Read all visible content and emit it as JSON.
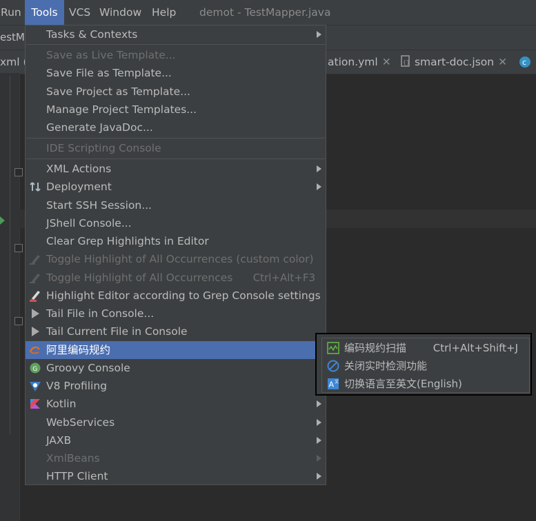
{
  "menubar": {
    "run": "Run",
    "tools": "Tools",
    "vcs": "VCS",
    "window": "Window",
    "help": "Help",
    "window_title": "demot - TestMapper.java"
  },
  "navbar": {
    "crumb": "estMa"
  },
  "tabs": [
    {
      "label": "xml (c"
    },
    {
      "label": "ation.yml"
    },
    {
      "label": "smart-doc.json"
    }
  ],
  "tools_menu": {
    "items": [
      {
        "label": "Tasks & Contexts",
        "submenu": true
      },
      {
        "label": "Save as Live Template...",
        "disabled": true
      },
      {
        "label": "Save File as Template..."
      },
      {
        "label": "Save Project as Template..."
      },
      {
        "label": "Manage Project Templates..."
      },
      {
        "label": "Generate JavaDoc..."
      },
      {
        "label": "IDE Scripting Console",
        "disabled": true
      },
      {
        "label": "XML Actions",
        "submenu": true
      },
      {
        "label": "Deployment",
        "submenu": true,
        "icon": "deployment-icon"
      },
      {
        "label": "Start SSH Session..."
      },
      {
        "label": "JShell Console..."
      },
      {
        "label": "Clear Grep Highlights in Editor"
      },
      {
        "label": "Toggle Highlight of All Occurrences (custom color)",
        "disabled": true,
        "icon": "highlighter-icon"
      },
      {
        "label": "Toggle Highlight of All Occurrences",
        "disabled": true,
        "icon": "highlighter-icon",
        "shortcut": "Ctrl+Alt+F3"
      },
      {
        "label": "Highlight Editor according to Grep Console settings",
        "icon": "highlighter-red-icon"
      },
      {
        "label": "Tail File in Console...",
        "icon": "play-icon"
      },
      {
        "label": "Tail Current File in Console",
        "icon": "play-icon"
      },
      {
        "label": "阿里编码规约",
        "submenu": true,
        "selected": true,
        "icon": "alibaba-icon"
      },
      {
        "label": "Groovy Console",
        "icon": "groovy-icon"
      },
      {
        "label": "V8 Profiling",
        "submenu": true,
        "icon": "v8-icon"
      },
      {
        "label": "Kotlin",
        "submenu": true,
        "icon": "kotlin-icon"
      },
      {
        "label": "WebServices",
        "submenu": true
      },
      {
        "label": "JAXB",
        "submenu": true
      },
      {
        "label": "XmlBeans",
        "submenu": true,
        "disabled": true
      },
      {
        "label": "HTTP Client",
        "submenu": true
      }
    ]
  },
  "alibaba_submenu": {
    "items": [
      {
        "label": "编码规约扫描",
        "shortcut": "Ctrl+Alt+Shift+J",
        "icon": "scan-chart-icon"
      },
      {
        "label": "关闭实时检测功能",
        "icon": "disable-circle-icon"
      },
      {
        "label": "切换语言至英文(English)",
        "icon": "translate-icon"
      }
    ]
  },
  "colors": {
    "menu_bg": "#3c3f41",
    "selection": "#4b6eaf",
    "disabled_text": "#6f6f6f",
    "text": "#bbbbbb"
  }
}
